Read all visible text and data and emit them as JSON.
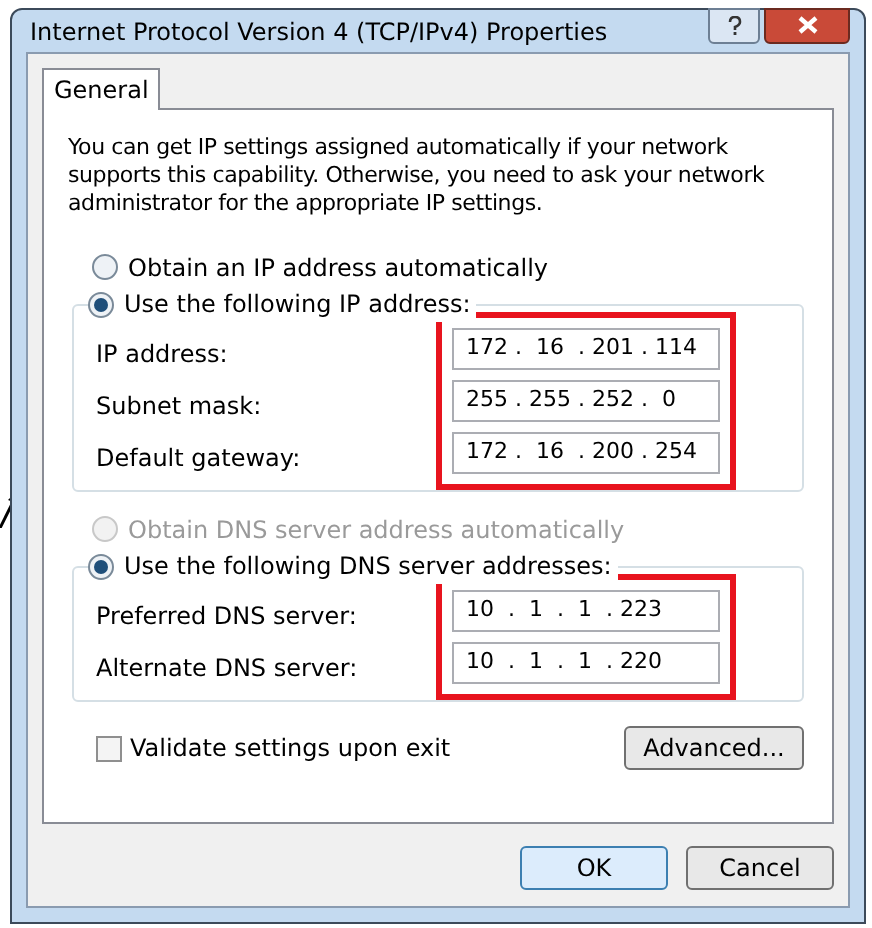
{
  "window": {
    "title": "Internet Protocol Version 4 (TCP/IPv4) Properties"
  },
  "tabs": [
    {
      "label": "General",
      "selected": true
    }
  ],
  "intro": "You can get IP settings assigned automatically if your network supports this capability. Otherwise, you need to ask your network administrator for the appropriate IP settings.",
  "ip_options": [
    {
      "label": "Obtain an IP address automatically",
      "selected": false,
      "disabled": false
    },
    {
      "label": "Use the following IP address:",
      "selected": true,
      "disabled": false
    }
  ],
  "ip_fields": [
    {
      "label": "IP address:",
      "value": "172 .  16  . 201 . 114"
    },
    {
      "label": "Subnet mask:",
      "value": "255 . 255 . 252 .  0"
    },
    {
      "label": "Default gateway:",
      "value": "172 .  16  . 200 . 254"
    }
  ],
  "dns_options": [
    {
      "label": "Obtain DNS server address automatically",
      "selected": false,
      "disabled": true
    },
    {
      "label": "Use the following DNS server addresses:",
      "selected": true,
      "disabled": false
    }
  ],
  "dns_fields": [
    {
      "label": "Preferred DNS server:",
      "value": "10  .  1  .  1  . 223"
    },
    {
      "label": "Alternate DNS server:",
      "value": "10  .  1  .  1  . 220"
    }
  ],
  "validate": {
    "label": "Validate settings upon exit",
    "checked": false
  },
  "advanced_button": "Advanced...",
  "buttons": [
    {
      "label": "OK",
      "default": true
    },
    {
      "label": "Cancel",
      "default": false
    }
  ]
}
